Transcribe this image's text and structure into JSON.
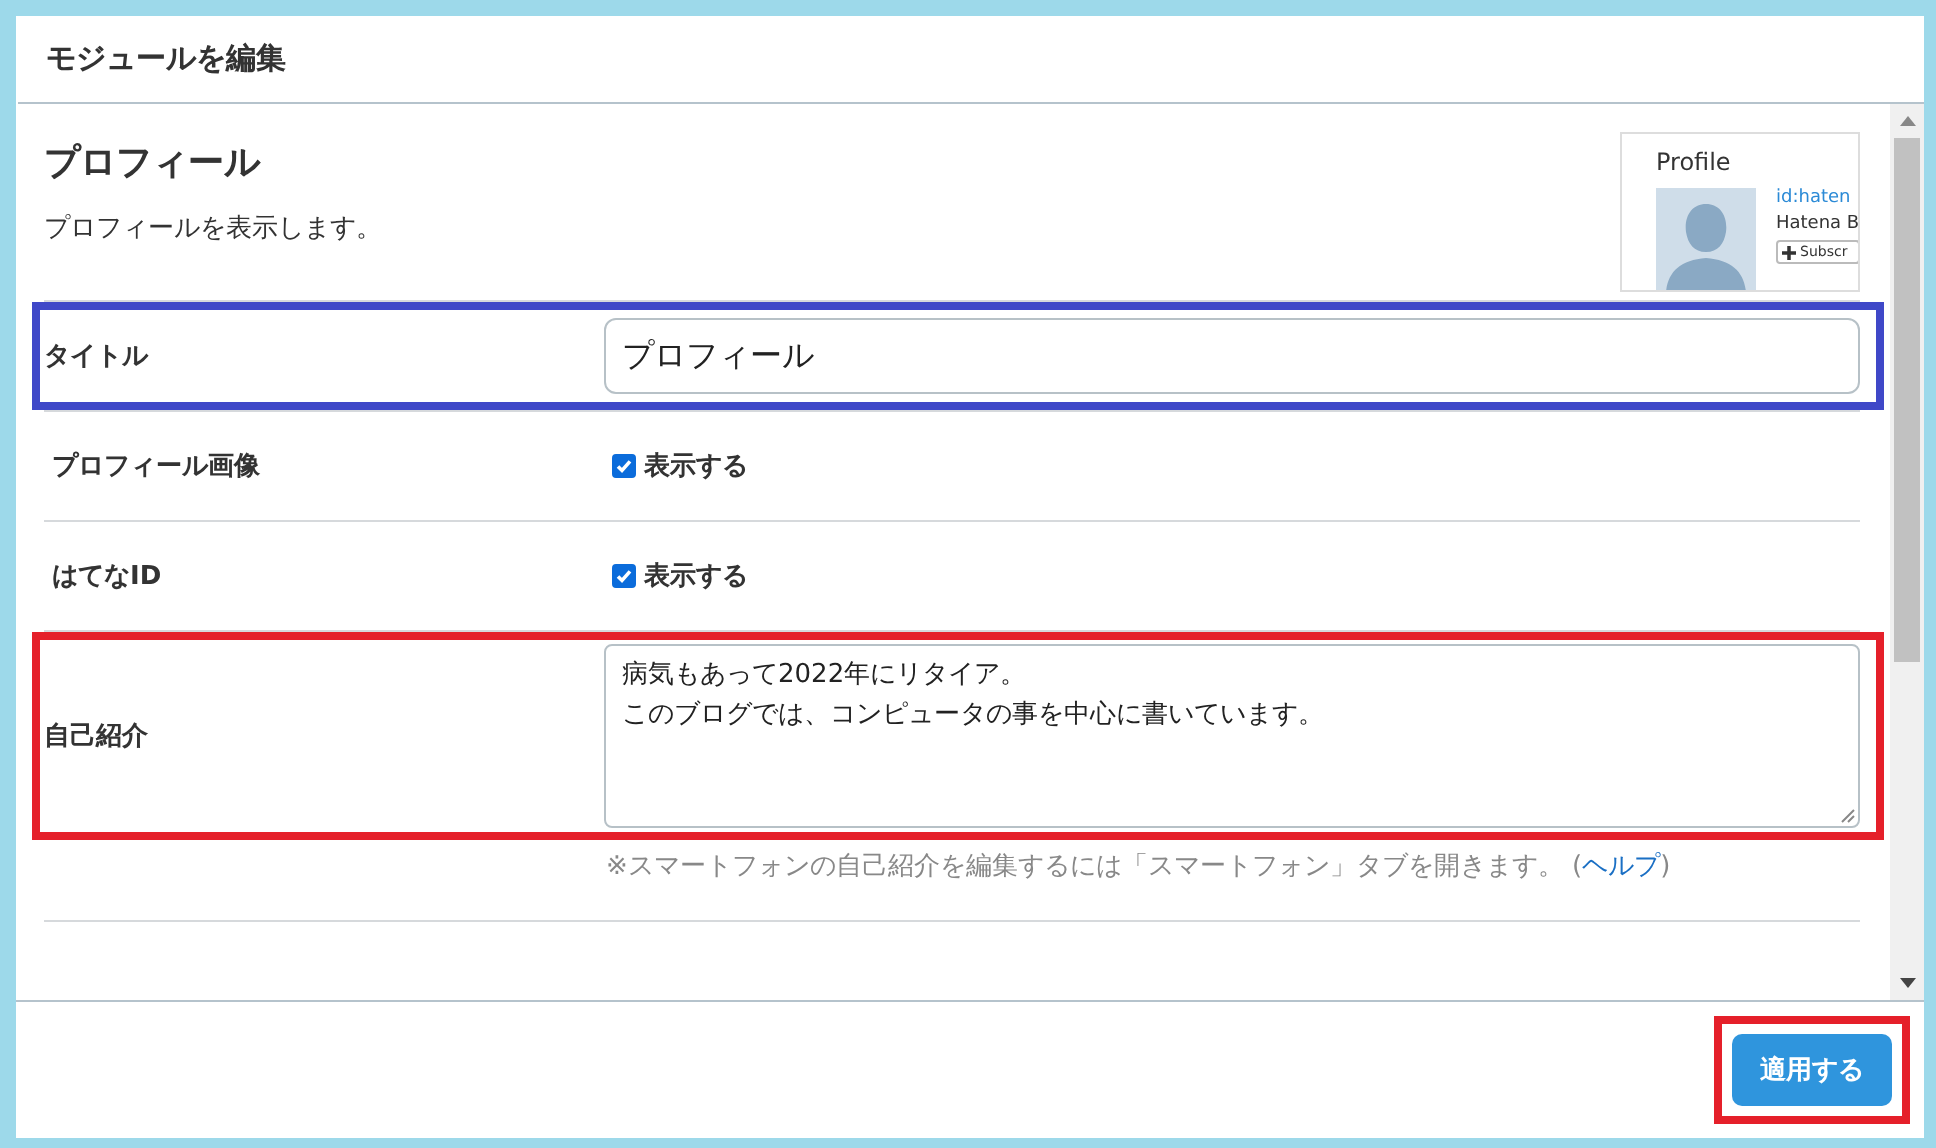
{
  "dialog": {
    "title": "モジュールを編集"
  },
  "module": {
    "name": "プロフィール",
    "description": "プロフィールを表示します。",
    "preview": {
      "heading": "Profile",
      "id_link": "id:haten",
      "name": "Hatena B",
      "button": "Subscr"
    }
  },
  "rows": [
    {
      "kind": "text",
      "label": "タイトル",
      "value": "プロフィール",
      "color": "#3f48c8"
    },
    {
      "kind": "checkbox",
      "label": "プロフィール画像",
      "option": "表示する",
      "checked": true
    },
    {
      "kind": "checkbox",
      "label": "はてなID",
      "option": "表示する",
      "checked": true
    },
    {
      "kind": "textarea",
      "label": "自己紹介",
      "lines": [
        "病気もあって2022年にリタイア。",
        "このブログでは、コンピュータの事を中心に書いています。"
      ],
      "note": "※スマートフォンの自己紹介を編集するには「スマートフォン」タブを開きます。",
      "help_open": "(",
      "help_link": "ヘルプ",
      "help_close": ")",
      "color": "#e5202a"
    }
  ],
  "footer": {
    "apply_button": "適用する",
    "color": "#e5202a"
  }
}
